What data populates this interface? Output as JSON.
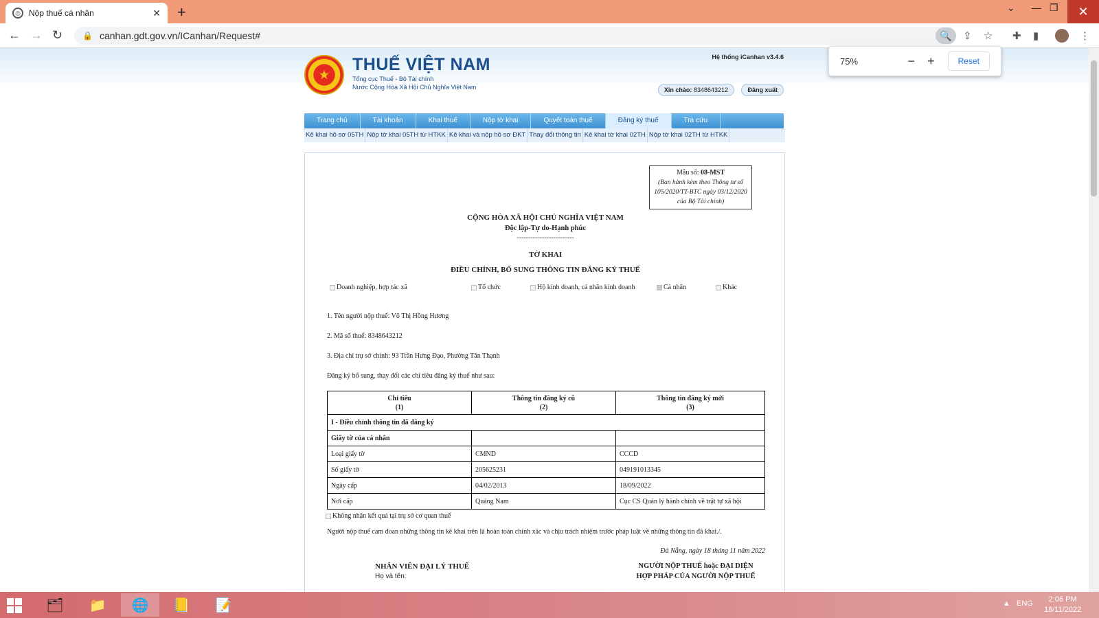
{
  "browser": {
    "tab_title": "Nộp thuế cá nhân",
    "url": "canhan.gdt.gov.vn/ICanhan/Request#",
    "zoom": {
      "percent": "75%",
      "minus": "−",
      "plus": "+",
      "reset": "Reset"
    }
  },
  "site": {
    "brand_name": "THUẾ VIỆT NAM",
    "brand_sub1": "Tổng cục Thuế - Bộ Tài chính",
    "brand_sub2": "Nước Cộng Hòa Xã Hội Chủ Nghĩa Việt Nam",
    "system_version": "Hệ thống iCanhan v3.4.6",
    "greeting_label": "Xin chào:",
    "greeting_user": "8348643212",
    "logout": "Đăng xuất"
  },
  "main_nav": [
    {
      "label": "Trang chủ"
    },
    {
      "label": "Tài khoản"
    },
    {
      "label": "Khai thuế"
    },
    {
      "label": "Nộp tờ khai"
    },
    {
      "label": "Quyết toán thuế"
    },
    {
      "label": "Đăng ký thuế"
    },
    {
      "label": "Tra cứu"
    }
  ],
  "sub_nav": [
    {
      "label": "Kê khai hồ sơ 05TH"
    },
    {
      "label": "Nộp tờ khai 05TH từ HTKK"
    },
    {
      "label": "Kê khai và nộp hồ sơ ĐKT"
    },
    {
      "label": "Thay đổi thông tin"
    },
    {
      "label": "Kê khai tờ khai 02TH"
    },
    {
      "label": "Nộp tờ khai 02TH từ HTKK"
    }
  ],
  "form": {
    "mau_so_label": "Mẫu số:",
    "mau_so_code": "08-MST",
    "mau_so_note": "(Ban hành kèm theo Thông tư số 105/2020/TT-BTC ngày 03/12/2020 của Bộ Tài chính)",
    "country": "CỘNG HÒA XÃ HỘI CHỦ NGHĨA VIỆT NAM",
    "motto": "Độc lập-Tự do-Hạnh phúc",
    "separator": "-------------------------",
    "doc_title": "TỜ KHAI",
    "doc_subtitle": "ĐIỀU CHỈNH, BỔ SUNG THÔNG TIN ĐĂNG KÝ THUẾ",
    "options": [
      {
        "label": "Doanh nghiệp, hợp tác xã",
        "checked": false
      },
      {
        "label": "Tổ chức",
        "checked": false
      },
      {
        "label": "Hộ kinh doanh, cá nhân kinh doanh",
        "checked": false
      },
      {
        "label": "Cá nhân",
        "checked": true
      },
      {
        "label": "Khác",
        "checked": false
      }
    ],
    "line1": "1. Tên người nộp thuế: Võ Thị Hồng Hương",
    "line2": "2. Mã số thuế: 8348643212",
    "line3": "3. Địa chỉ trụ sở chính: 93 Trần Hưng Đạo, Phường Tân Thạnh",
    "line4": "Đăng ký bổ sung, thay đổi các chỉ tiêu đăng ký thuế như sau:",
    "table": {
      "headers": [
        {
          "title": "Chỉ tiêu",
          "num": "(1)"
        },
        {
          "title": "Thông tin đăng ký cũ",
          "num": "(2)"
        },
        {
          "title": "Thông tin đăng ký mới",
          "num": "(3)"
        }
      ],
      "section": "I - Điều chỉnh thông tin đã đăng ký",
      "group": "Giấy tờ của cá nhân",
      "rows": [
        {
          "label": "Loại giấy tờ",
          "old": "CMND",
          "new": "CCCD"
        },
        {
          "label": "Số giấy tờ",
          "old": "205625231",
          "new": "049191013345"
        },
        {
          "label": "Ngày cấp",
          "old": "04/02/2013",
          "new": "18/09/2022"
        },
        {
          "label": "Nơi cấp",
          "old": "Quảng Nam",
          "new": "Cục CS Quản lý hành chính về trật tự xã hội"
        }
      ]
    },
    "receive_option": "Không nhận kết quả tại trụ sở cơ quan thuế",
    "commitment": "Người nộp thuế cam đoan những thông tin kê khai trên là hoàn toàn chính xác và chịu trách nhiệm trước pháp luật về những thông tin đã khai./.",
    "place_date": "Đà Nẵng, ngày 18 tháng 11 năm 2022",
    "agent_title": "NHÂN VIÊN ĐẠI LÝ THUẾ",
    "agent_name_label": "Họ và tên:",
    "payer_title_1": "NGƯỜI NỘP THUẾ hoặc ĐẠI DIỆN",
    "payer_title_2": "HỢP PHÁP CỦA NGƯỜI NỘP THUẾ"
  },
  "taskbar": {
    "lang": "ENG",
    "time": "2:06 PM",
    "date": "18/11/2022"
  }
}
